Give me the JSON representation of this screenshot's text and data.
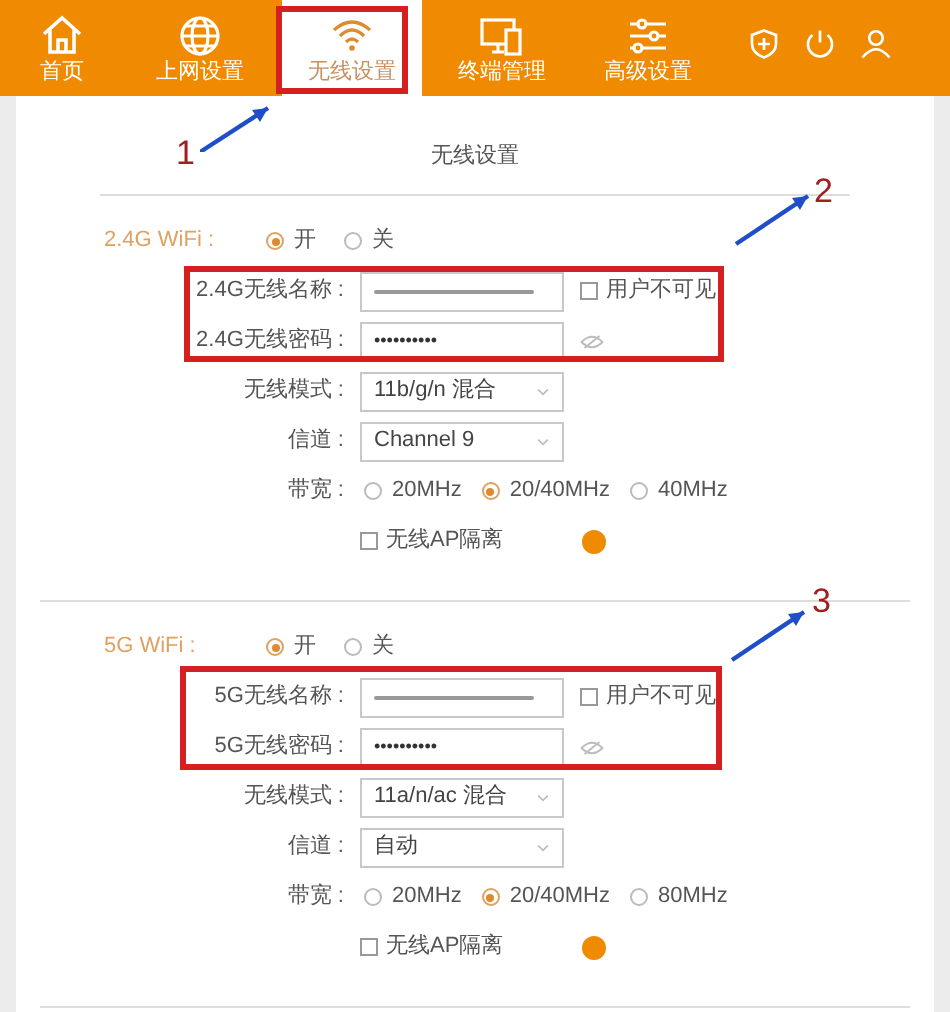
{
  "nav": {
    "items": [
      {
        "label": "首页",
        "selected": false
      },
      {
        "label": "上网设置",
        "selected": false
      },
      {
        "label": "无线设置",
        "selected": true
      },
      {
        "label": "终端管理",
        "selected": false
      },
      {
        "label": "高级设置",
        "selected": false
      }
    ]
  },
  "page_title": "无线设置",
  "sections": [
    {
      "label": "2.4G WiFi :",
      "switch": [
        {
          "label": "开",
          "selected": true
        },
        {
          "label": "关",
          "selected": false
        }
      ],
      "rows": [
        {
          "kind": "ssid",
          "label": "2.4G无线名称 :",
          "hidden_label": "用户不可见",
          "hidden_checked": false
        },
        {
          "kind": "password",
          "label": "2.4G无线密码 :",
          "value": "••••••••••"
        },
        {
          "kind": "select",
          "label": "无线模式 :",
          "value": "11b/g/n 混合"
        },
        {
          "kind": "select",
          "label": "信道 :",
          "value": "Channel 9"
        },
        {
          "kind": "radios",
          "label": "带宽 :",
          "options": [
            {
              "label": "20MHz",
              "selected": false
            },
            {
              "label": "20/40MHz",
              "selected": true
            },
            {
              "label": "40MHz",
              "selected": false
            }
          ]
        },
        {
          "kind": "checkbox",
          "label": "无线AP隔离",
          "checked": false
        }
      ]
    },
    {
      "label": "5G WiFi :",
      "switch": [
        {
          "label": "开",
          "selected": true
        },
        {
          "label": "关",
          "selected": false
        }
      ],
      "rows": [
        {
          "kind": "ssid",
          "label": "5G无线名称 :",
          "hidden_label": "用户不可见",
          "hidden_checked": false
        },
        {
          "kind": "password",
          "label": "5G无线密码 :",
          "value": "••••••••••"
        },
        {
          "kind": "select",
          "label": "无线模式 :",
          "value": "11a/n/ac 混合"
        },
        {
          "kind": "select",
          "label": "信道 :",
          "value": "自动"
        },
        {
          "kind": "radios",
          "label": "带宽 :",
          "options": [
            {
              "label": "20MHz",
              "selected": false
            },
            {
              "label": "20/40MHz",
              "selected": true
            },
            {
              "label": "80MHz",
              "selected": false
            }
          ]
        },
        {
          "kind": "checkbox",
          "label": "无线AP隔离",
          "checked": false
        }
      ]
    }
  ],
  "annotations": [
    {
      "label": "1"
    },
    {
      "label": "2"
    },
    {
      "label": "3"
    }
  ]
}
